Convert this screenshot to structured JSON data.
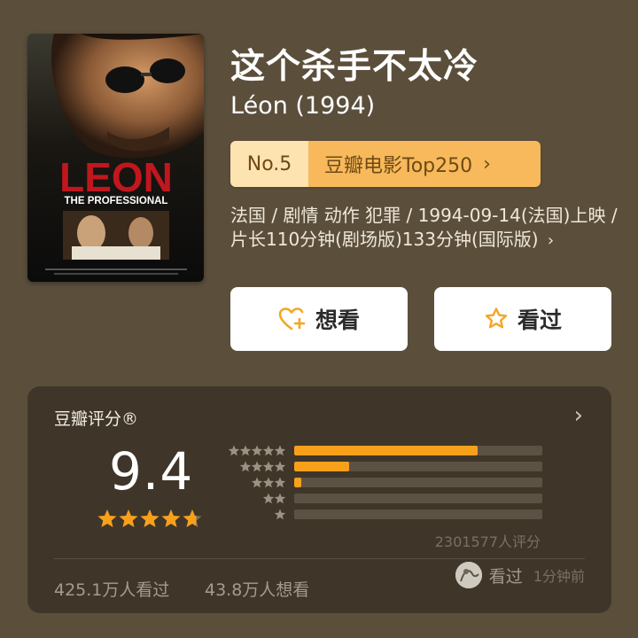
{
  "movie": {
    "title": "这个杀手不太冷",
    "original_title": "Léon (1994)",
    "poster": {
      "title_text": "LEON",
      "tagline_text": "THE PROFESSIONAL"
    },
    "rank": {
      "number": "No.5",
      "label": "豆瓣电影Top250",
      "chevron": "chevron-right-icon"
    },
    "meta": "法国 / 剧情 动作 犯罪 / 1994-09-14(法国)上映 / 片长110分钟(剧场版)133分钟(国际版)"
  },
  "actions": {
    "want_label": "想看",
    "want_icon": "heart-plus-icon",
    "seen_label": "看过",
    "seen_icon": "star-outline-icon"
  },
  "rating": {
    "title": "豆瓣评分®",
    "score": "9.4",
    "stars": 4.7,
    "distribution": [
      {
        "stars": 5,
        "fraction": 0.74
      },
      {
        "stars": 4,
        "fraction": 0.22
      },
      {
        "stars": 3,
        "fraction": 0.03
      },
      {
        "stars": 2,
        "fraction": 0.0
      },
      {
        "stars": 1,
        "fraction": 0.0
      }
    ],
    "count_text": "2301577人评分",
    "watched_text": "425.1万人看过",
    "wanted_text": "43.8万人想看",
    "recent": {
      "status": "看过",
      "time": "1分钟前"
    }
  },
  "colors": {
    "background": "#5b4f3c",
    "card": "#3f3629",
    "accent": "#f9a01b",
    "rank_badge": "#f7b95c",
    "poster_red": "#c0171e"
  }
}
